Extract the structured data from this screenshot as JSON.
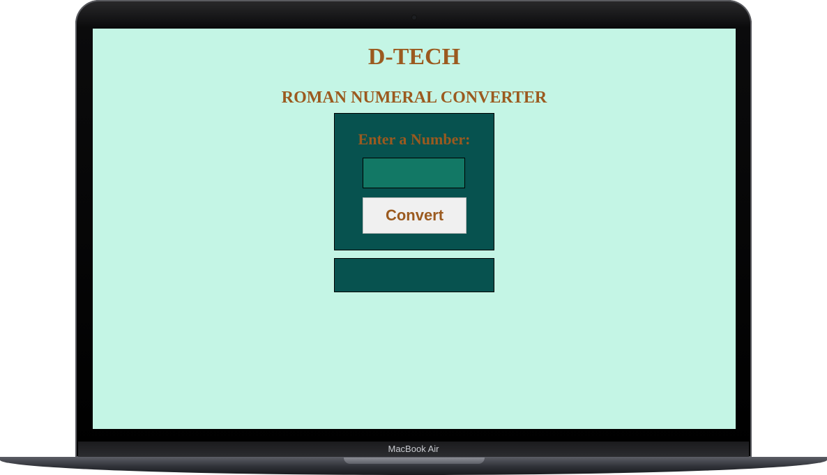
{
  "device": {
    "brand_label": "MacBook Air"
  },
  "app": {
    "title": "D-TECH",
    "subtitle": "ROMAN NUMERAL CONVERTER",
    "form": {
      "label": "Enter a Number:",
      "input_value": "",
      "button_label": "Convert"
    },
    "result": {
      "text": ""
    }
  },
  "colors": {
    "screen_background": "#c4f5e5",
    "panel": "#07524f",
    "input": "#127865",
    "accent_text": "#9b5a1f",
    "button": "#f0f0f0"
  }
}
